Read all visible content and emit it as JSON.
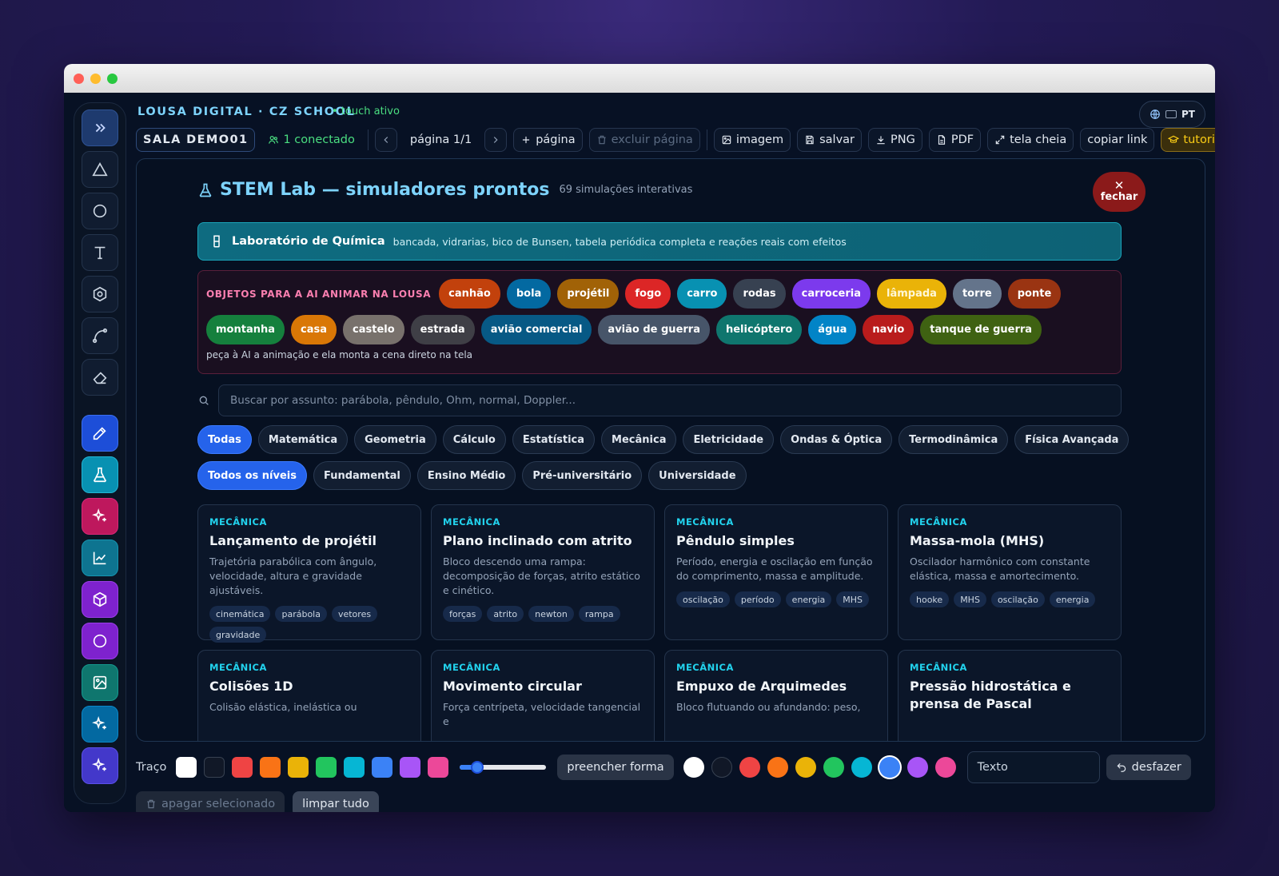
{
  "header": {
    "title": "LOUSA DIGITAL · CZ SCHOOL",
    "touch": "• touch ativo",
    "lang": "PT"
  },
  "topbar": {
    "room": "SALA DEMO01",
    "connected": "1 conectado",
    "page": "página 1/1",
    "add_page": "página",
    "delete_page": "excluir página",
    "image": "imagem",
    "save": "salvar",
    "png": "PNG",
    "pdf": "PDF",
    "fullscreen": "tela cheia",
    "copy_link": "copiar link",
    "tutorial": "tutorial"
  },
  "stem": {
    "title": "STEM Lab — simuladores prontos",
    "subtitle": "69 simulações interativas",
    "close": "fechar",
    "chem_title": "Laboratório de Química",
    "chem_desc": "bancada, vidrarias, bico de Bunsen, tabela periódica completa e reações reais com efeitos",
    "objects_label": "OBJETOS PARA A AI ANIMAR NA LOUSA",
    "objects": [
      {
        "label": "canhão",
        "color": "#c2410c"
      },
      {
        "label": "bola",
        "color": "#0369a1"
      },
      {
        "label": "projétil",
        "color": "#a16207"
      },
      {
        "label": "fogo",
        "color": "#dc2626"
      },
      {
        "label": "carro",
        "color": "#0891b2"
      },
      {
        "label": "rodas",
        "color": "#374151"
      },
      {
        "label": "carroceria",
        "color": "#7c3aed"
      },
      {
        "label": "lâmpada",
        "color": "#eab308"
      },
      {
        "label": "torre",
        "color": "#64748b"
      },
      {
        "label": "ponte",
        "color": "#9a3412"
      },
      {
        "label": "montanha",
        "color": "#15803d"
      },
      {
        "label": "casa",
        "color": "#d97706"
      },
      {
        "label": "castelo",
        "color": "#78716c"
      },
      {
        "label": "estrada",
        "color": "#3f3f46"
      },
      {
        "label": "avião comercial",
        "color": "#075985"
      },
      {
        "label": "avião de guerra",
        "color": "#475569"
      },
      {
        "label": "helicóptero",
        "color": "#0f766e"
      },
      {
        "label": "água",
        "color": "#0284c7"
      },
      {
        "label": "navio",
        "color": "#b91c1c"
      },
      {
        "label": "tanque de guerra",
        "color": "#3f6212"
      }
    ],
    "objects_hint": "peça à AI a animação e ela monta a cena direto na tela",
    "search_placeholder": "Buscar por assunto: parábola, pêndulo, Ohm, normal, Doppler...",
    "subjects": [
      "Todas",
      "Matemática",
      "Geometria",
      "Cálculo",
      "Estatística",
      "Mecânica",
      "Eletricidade",
      "Ondas & Óptica",
      "Termodinâmica",
      "Física Avançada"
    ],
    "levels": [
      "Todos os níveis",
      "Fundamental",
      "Ensino Médio",
      "Pré-universitário",
      "Universidade"
    ],
    "cards": [
      {
        "cat": "MECÂNICA",
        "title": "Lançamento de projétil",
        "desc": "Trajetória parabólica com ângulo, velocidade, altura e gravidade ajustáveis.",
        "tags": [
          "cinemática",
          "parábola",
          "vetores",
          "gravidade"
        ]
      },
      {
        "cat": "MECÂNICA",
        "title": "Plano inclinado com atrito",
        "desc": "Bloco descendo uma rampa: decomposição de forças, atrito estático e cinético.",
        "tags": [
          "forças",
          "atrito",
          "newton",
          "rampa"
        ]
      },
      {
        "cat": "MECÂNICA",
        "title": "Pêndulo simples",
        "desc": "Período, energia e oscilação em função do comprimento, massa e amplitude.",
        "tags": [
          "oscilação",
          "período",
          "energia",
          "MHS"
        ]
      },
      {
        "cat": "MECÂNICA",
        "title": "Massa-mola (MHS)",
        "desc": "Oscilador harmônico com constante elástica, massa e amortecimento.",
        "tags": [
          "hooke",
          "MHS",
          "oscilação",
          "energia"
        ]
      },
      {
        "cat": "MECÂNICA",
        "title": "Colisões 1D",
        "desc": "Colisão elástica, inelástica ou",
        "tags": []
      },
      {
        "cat": "MECÂNICA",
        "title": "Movimento circular",
        "desc": "Força centrípeta, velocidade tangencial e",
        "tags": []
      },
      {
        "cat": "MECÂNICA",
        "title": "Empuxo de Arquimedes",
        "desc": "Bloco flutuando ou afundando: peso,",
        "tags": []
      },
      {
        "cat": "MECÂNICA",
        "title": "Pressão hidrostática e prensa de Pascal",
        "desc": "",
        "tags": []
      }
    ]
  },
  "bottom": {
    "stroke_label": "Traço",
    "stroke_colors": [
      "#ffffff",
      "#111827",
      "#ef4444",
      "#f97316",
      "#eab308",
      "#22c55e",
      "#06b6d4",
      "#3b82f6",
      "#a855f7",
      "#ec4899"
    ],
    "fill_button": "preencher forma",
    "fill_colors": [
      "#ffffff",
      "#111827",
      "#ef4444",
      "#f97316",
      "#eab308",
      "#22c55e",
      "#06b6d4",
      "#3b82f6",
      "#a855f7",
      "#ec4899"
    ],
    "text_placeholder": "Texto",
    "undo": "desfazer",
    "delete_selected": "apagar selecionado",
    "clear_all": "limpar tudo",
    "stroke_width_fraction": 0.2
  }
}
